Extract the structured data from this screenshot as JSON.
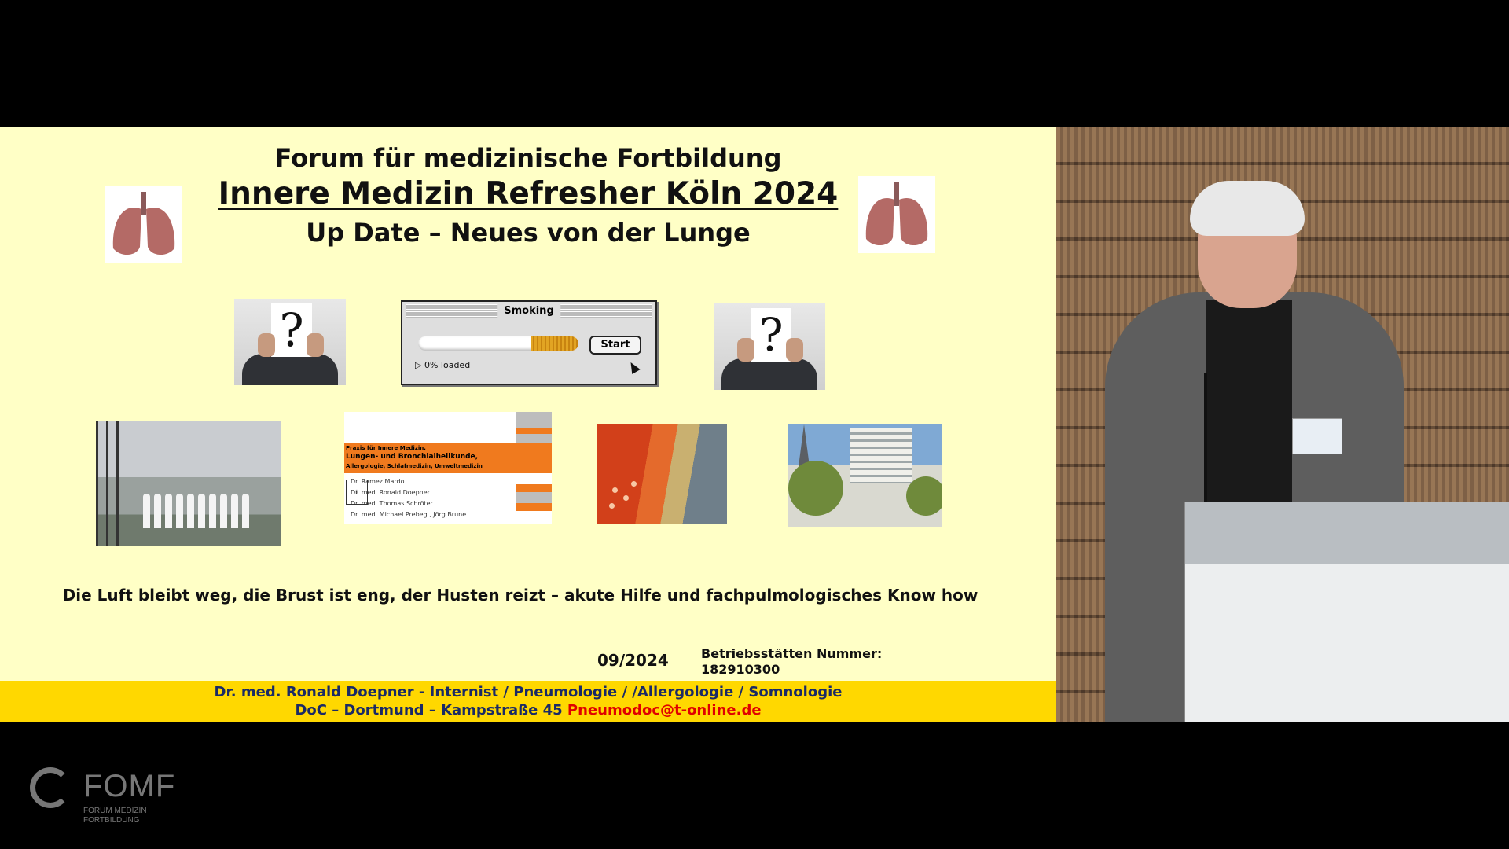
{
  "slide": {
    "title_line1": "Forum für medizinische Fortbildung",
    "title_line2": "Innere Medizin Refresher Köln 2024",
    "title_line3": "Up Date – Neues von der Lunge",
    "dialog": {
      "title": "Smoking",
      "button": "Start",
      "status": "0% loaded",
      "progress_fraction": 0.3
    },
    "practice_card": {
      "header1": "Praxis für Innere Medizin,",
      "header2": "Lungen- und Bronchialheilkunde,",
      "header3": "Allergologie, Schlafmedizin, Umweltmedizin",
      "doctors": [
        "Dr. Ramez Mardo",
        "Dr. med. Ronald Doepner",
        "Dr. med. Thomas Schröter",
        "Dr. med. Michael Prebeg , Jörg Brune"
      ]
    },
    "subtitle": "Die Luft bleibt weg, die Brust ist eng, der Husten reizt – akute Hilfe und fachpulmologisches Know how",
    "date": "09/2024",
    "bsnr_label": "Betriebsstätten Nummer:",
    "bsnr_value": "182910300",
    "footer": {
      "line1": "Dr. med. Ronald Doepner - Internist / Pneumologie / /Allergologie / Somnologie",
      "line2": "DoC – Dortmund – Kampstraße 45",
      "email": "Pneumodoc@t-online.de"
    }
  },
  "watermark": {
    "brand": "FOMF",
    "sub_line1": "FORUM MEDIZIN",
    "sub_line2": "FORTBILDUNG"
  },
  "colors": {
    "slide_bg": "#ffffc6",
    "footer_bg": "#ffd800",
    "footer_text": "#1a2a66",
    "email": "#e00000"
  },
  "icons": [
    "lungs-icon",
    "question-sign-icon",
    "mouse-cursor-icon",
    "fomf-logo-icon"
  ]
}
